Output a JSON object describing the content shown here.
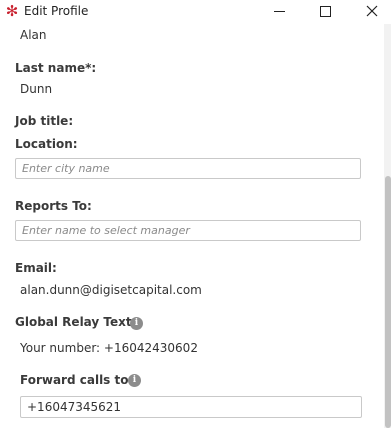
{
  "window": {
    "title": "Edit Profile",
    "app_icon": "asterisk-logo-icon",
    "accent_color": "#c8202e"
  },
  "form": {
    "first_name_value": "Alan",
    "last_name_label": "Last name*:",
    "last_name_value": "Dunn",
    "job_title_label": "Job title:",
    "location_label": "Location:",
    "location_placeholder": "Enter city name",
    "reports_to_label": "Reports To:",
    "reports_to_placeholder": "Enter name to select manager",
    "email_label": "Email:",
    "email_value": "alan.dunn@digisetcapital.com",
    "global_relay_label": "Global Relay Text:",
    "global_relay_value": "Your number: +16042430602",
    "forward_calls_label": "Forward calls to:",
    "forward_calls_value": "+16047345621"
  },
  "icons": {
    "info": "i"
  }
}
